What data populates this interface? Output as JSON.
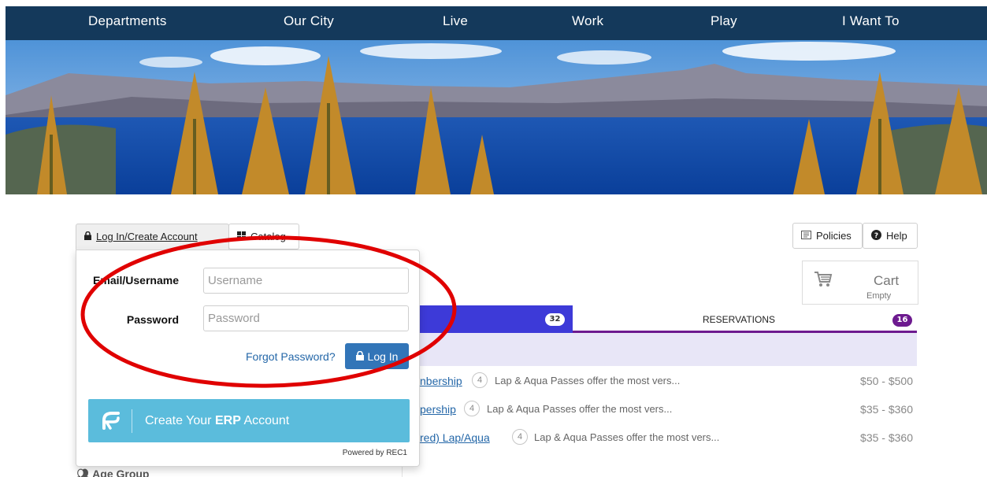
{
  "nav": {
    "items": [
      "Departments",
      "Our City",
      "Live",
      "Work",
      "Play",
      "I Want To"
    ]
  },
  "toolbar": {
    "login_tab": "Log In/Create Account",
    "catalog_tab": "Catalog",
    "policies": "Policies",
    "help": "Help"
  },
  "cart": {
    "label": "Cart",
    "status": "Empty"
  },
  "tabs": {
    "active_count": "32",
    "reservations_label": "RESERVATIONS",
    "reservations_count": "16"
  },
  "login_form": {
    "email_label": "Email/Username",
    "email_placeholder": "Username",
    "password_label": "Password",
    "password_placeholder": "Password",
    "forgot_link": "Forgot Password?",
    "login_button": "Log In",
    "erp_prefix": "Create Your",
    "erp_bold": "ERP",
    "erp_suffix": "Account",
    "powered_by": "Powered by REC1"
  },
  "rows": [
    {
      "title_fragment": "nbership",
      "count": "4",
      "description": "Lap & Aqua Passes offer the most vers...",
      "price": "$50 - $500"
    },
    {
      "title_fragment": "pership",
      "count": "4",
      "description": "Lap & Aqua Passes offer the most vers...",
      "price": "$35 - $360"
    },
    {
      "title_fragment": "red) Lap/Aqua",
      "count": "4",
      "description": "Lap & Aqua Passes offer the most vers...",
      "price": "$35 - $360"
    }
  ],
  "sidebar": {
    "age_group": "Age Group"
  },
  "colors": {
    "nav_bg": "#14395b",
    "active_tab": "#3d3ad8",
    "purple_accent": "#6d1a8f",
    "login_button": "#3275b8",
    "erp_button": "#5bbcdc",
    "annotation_red": "#e00000"
  }
}
